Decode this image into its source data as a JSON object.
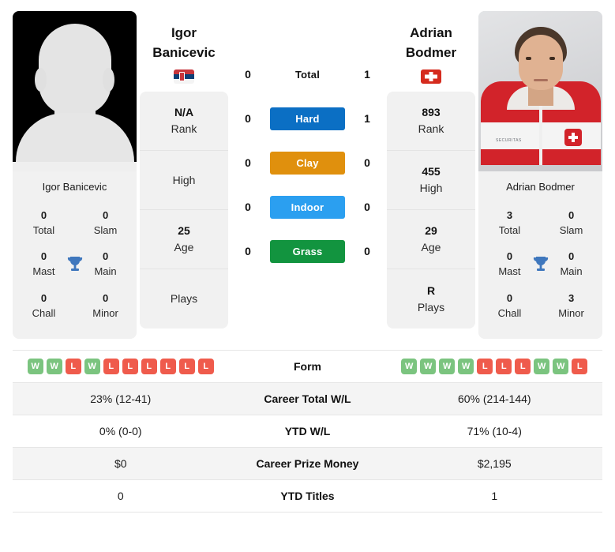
{
  "left_player": {
    "name": "Igor Banicevic",
    "first_name": "Igor",
    "last_name": "Banicevic",
    "photo_caption": "Igor Banicevic",
    "flag": "serbia-flag",
    "photo": "player-photo-placeholder",
    "info": [
      {
        "value": "N/A",
        "label": "Rank"
      },
      {
        "value": "",
        "label": "High"
      },
      {
        "value": "25",
        "label": "Age"
      },
      {
        "value": "",
        "label": "Plays"
      }
    ],
    "trophies": [
      {
        "value": "0",
        "label": "Total"
      },
      {
        "value": "0",
        "label": "Slam"
      },
      {
        "value": "0",
        "label": "Mast"
      },
      {
        "value": "0",
        "label": "Main"
      },
      {
        "value": "0",
        "label": "Chall"
      },
      {
        "value": "0",
        "label": "Minor"
      }
    ],
    "form": [
      "W",
      "W",
      "L",
      "W",
      "L",
      "L",
      "L",
      "L",
      "L",
      "L"
    ],
    "career_total_wl": "23% (12-41)",
    "ytd_wl": "0% (0-0)",
    "career_prize_money": "$0",
    "ytd_titles": "0"
  },
  "right_player": {
    "name": "Adrian Bodmer",
    "first_name": "Adrian",
    "last_name": "Bodmer",
    "photo_caption": "Adrian Bodmer",
    "flag": "switzerland-flag",
    "photo": "player-photo",
    "info": [
      {
        "value": "893",
        "label": "Rank"
      },
      {
        "value": "455",
        "label": "High"
      },
      {
        "value": "29",
        "label": "Age"
      },
      {
        "value": "R",
        "label": "Plays"
      }
    ],
    "trophies": [
      {
        "value": "3",
        "label": "Total"
      },
      {
        "value": "0",
        "label": "Slam"
      },
      {
        "value": "0",
        "label": "Mast"
      },
      {
        "value": "0",
        "label": "Main"
      },
      {
        "value": "0",
        "label": "Chall"
      },
      {
        "value": "3",
        "label": "Minor"
      }
    ],
    "form": [
      "W",
      "W",
      "W",
      "W",
      "L",
      "L",
      "L",
      "W",
      "W",
      "L"
    ],
    "career_total_wl": "60% (214-144)",
    "ytd_wl": "71% (10-4)",
    "career_prize_money": "$2,195",
    "ytd_titles": "1"
  },
  "surfaces": [
    {
      "label": "Total",
      "left": "0",
      "right": "1",
      "color": ""
    },
    {
      "label": "Hard",
      "left": "0",
      "right": "1",
      "color": "#0b6fc4"
    },
    {
      "label": "Clay",
      "left": "0",
      "right": "0",
      "color": "#e0900d"
    },
    {
      "label": "Indoor",
      "left": "0",
      "right": "0",
      "color": "#2b9ff0"
    },
    {
      "label": "Grass",
      "left": "0",
      "right": "0",
      "color": "#12943f"
    }
  ],
  "stats_rows": [
    {
      "label": "Form"
    },
    {
      "label": "Career Total W/L",
      "left": "23% (12-41)",
      "right": "60% (214-144)"
    },
    {
      "label": "YTD W/L",
      "left": "0% (0-0)",
      "right": "71% (10-4)"
    },
    {
      "label": "Career Prize Money",
      "left": "$0",
      "right": "$2,195"
    },
    {
      "label": "YTD Titles",
      "left": "0",
      "right": "1"
    }
  ],
  "colors": {
    "hard": "#0b6fc4",
    "clay": "#e0900d",
    "indoor": "#2b9ff0",
    "grass": "#12943f",
    "win": "#7bc47f",
    "loss": "#ef5b4c",
    "card_bg": "#f1f1f1",
    "trophy": "#3f77bd"
  }
}
